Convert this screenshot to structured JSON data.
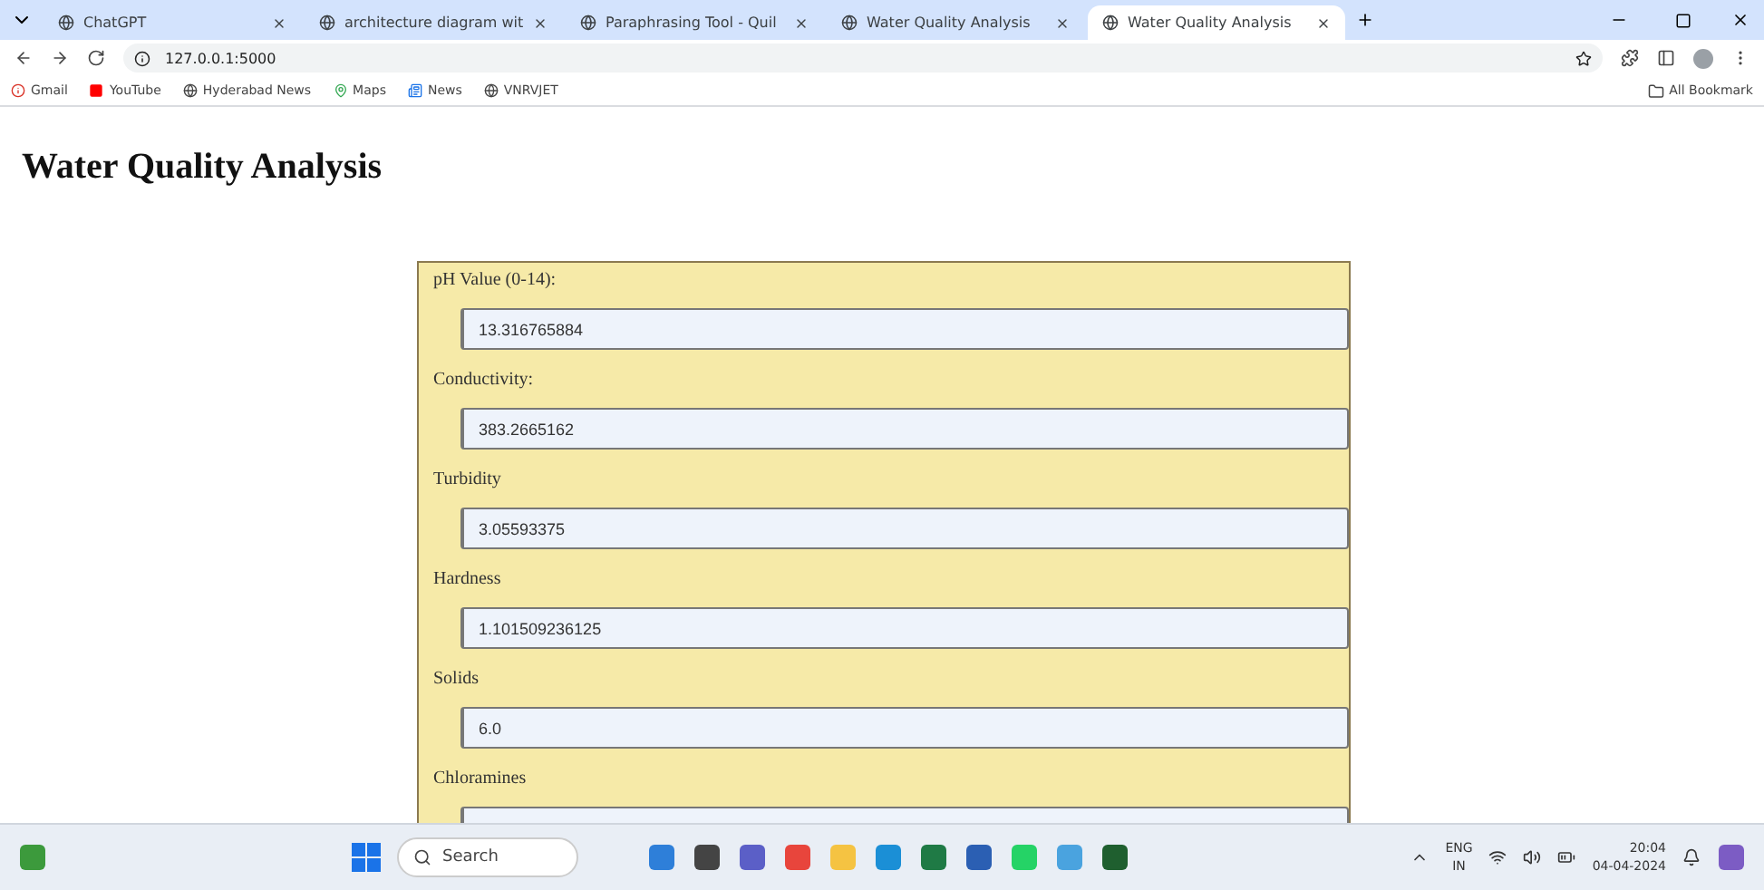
{
  "browser": {
    "tabs": [
      {
        "title": "ChatGPT",
        "selected": false
      },
      {
        "title": "architecture diagram wit",
        "selected": false
      },
      {
        "title": "Paraphrasing Tool - Quil",
        "selected": false
      },
      {
        "title": "Water Quality Analysis",
        "selected": false
      },
      {
        "title": "Water Quality Analysis",
        "selected": true
      }
    ],
    "url": "127.0.0.1:5000",
    "bookmarks": [
      "Gmail",
      "YouTube",
      "Hyderabad News",
      "Maps",
      "News",
      "VNRVJET"
    ],
    "all_bookmarks": "All Bookmark"
  },
  "page": {
    "heading": "Water Quality Analysis",
    "fields": [
      {
        "label": "pH Value (0-14):",
        "value": "13.316765884"
      },
      {
        "label": "Conductivity:",
        "value": "383.2665162"
      },
      {
        "label": "Turbidity",
        "value": "3.05593375"
      },
      {
        "label": "Hardness",
        "value": "1.101509236125"
      },
      {
        "label": "Solids",
        "value": "6.0"
      },
      {
        "label": "Chloramines"
      }
    ]
  },
  "taskbar": {
    "search": "Search",
    "language": "ENG",
    "region": "IN",
    "time": "20:04",
    "date": "04-04-2024"
  }
}
